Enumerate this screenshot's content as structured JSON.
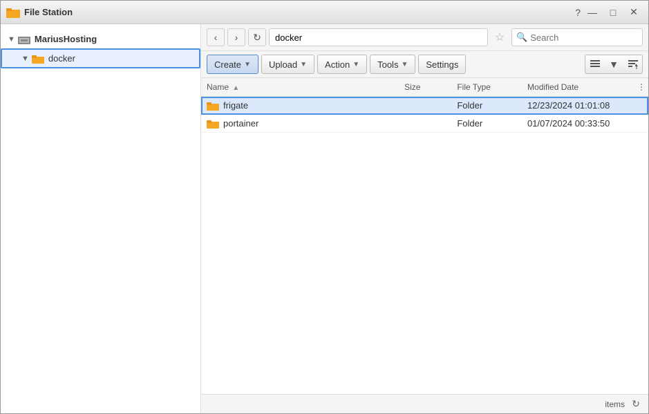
{
  "window": {
    "title": "File Station",
    "controls": {
      "help": "?",
      "minimize": "—",
      "maximize": "□",
      "close": "✕"
    }
  },
  "sidebar": {
    "host_label": "MariusHosting",
    "selected_folder": "docker",
    "items": [
      {
        "label": "docker",
        "selected": true
      }
    ]
  },
  "navbar": {
    "path": "docker",
    "search_placeholder": "Search"
  },
  "toolbar": {
    "create_label": "Create",
    "upload_label": "Upload",
    "action_label": "Action",
    "tools_label": "Tools",
    "settings_label": "Settings"
  },
  "table": {
    "columns": {
      "name": "Name",
      "size": "Size",
      "file_type": "File Type",
      "modified_date": "Modified Date"
    },
    "rows": [
      {
        "name": "frigate",
        "size": "",
        "file_type": "Folder",
        "modified_date": "12/23/2024 01:01:08",
        "selected": true
      },
      {
        "name": "portainer",
        "size": "",
        "file_type": "Folder",
        "modified_date": "01/07/2024 00:33:50",
        "selected": false
      }
    ]
  },
  "statusbar": {
    "items_label": "items"
  },
  "colors": {
    "folder_body": "#F5A623",
    "folder_tab": "#E8941A",
    "selected_border": "#4a90e2",
    "selected_bg": "#dce8fc"
  }
}
